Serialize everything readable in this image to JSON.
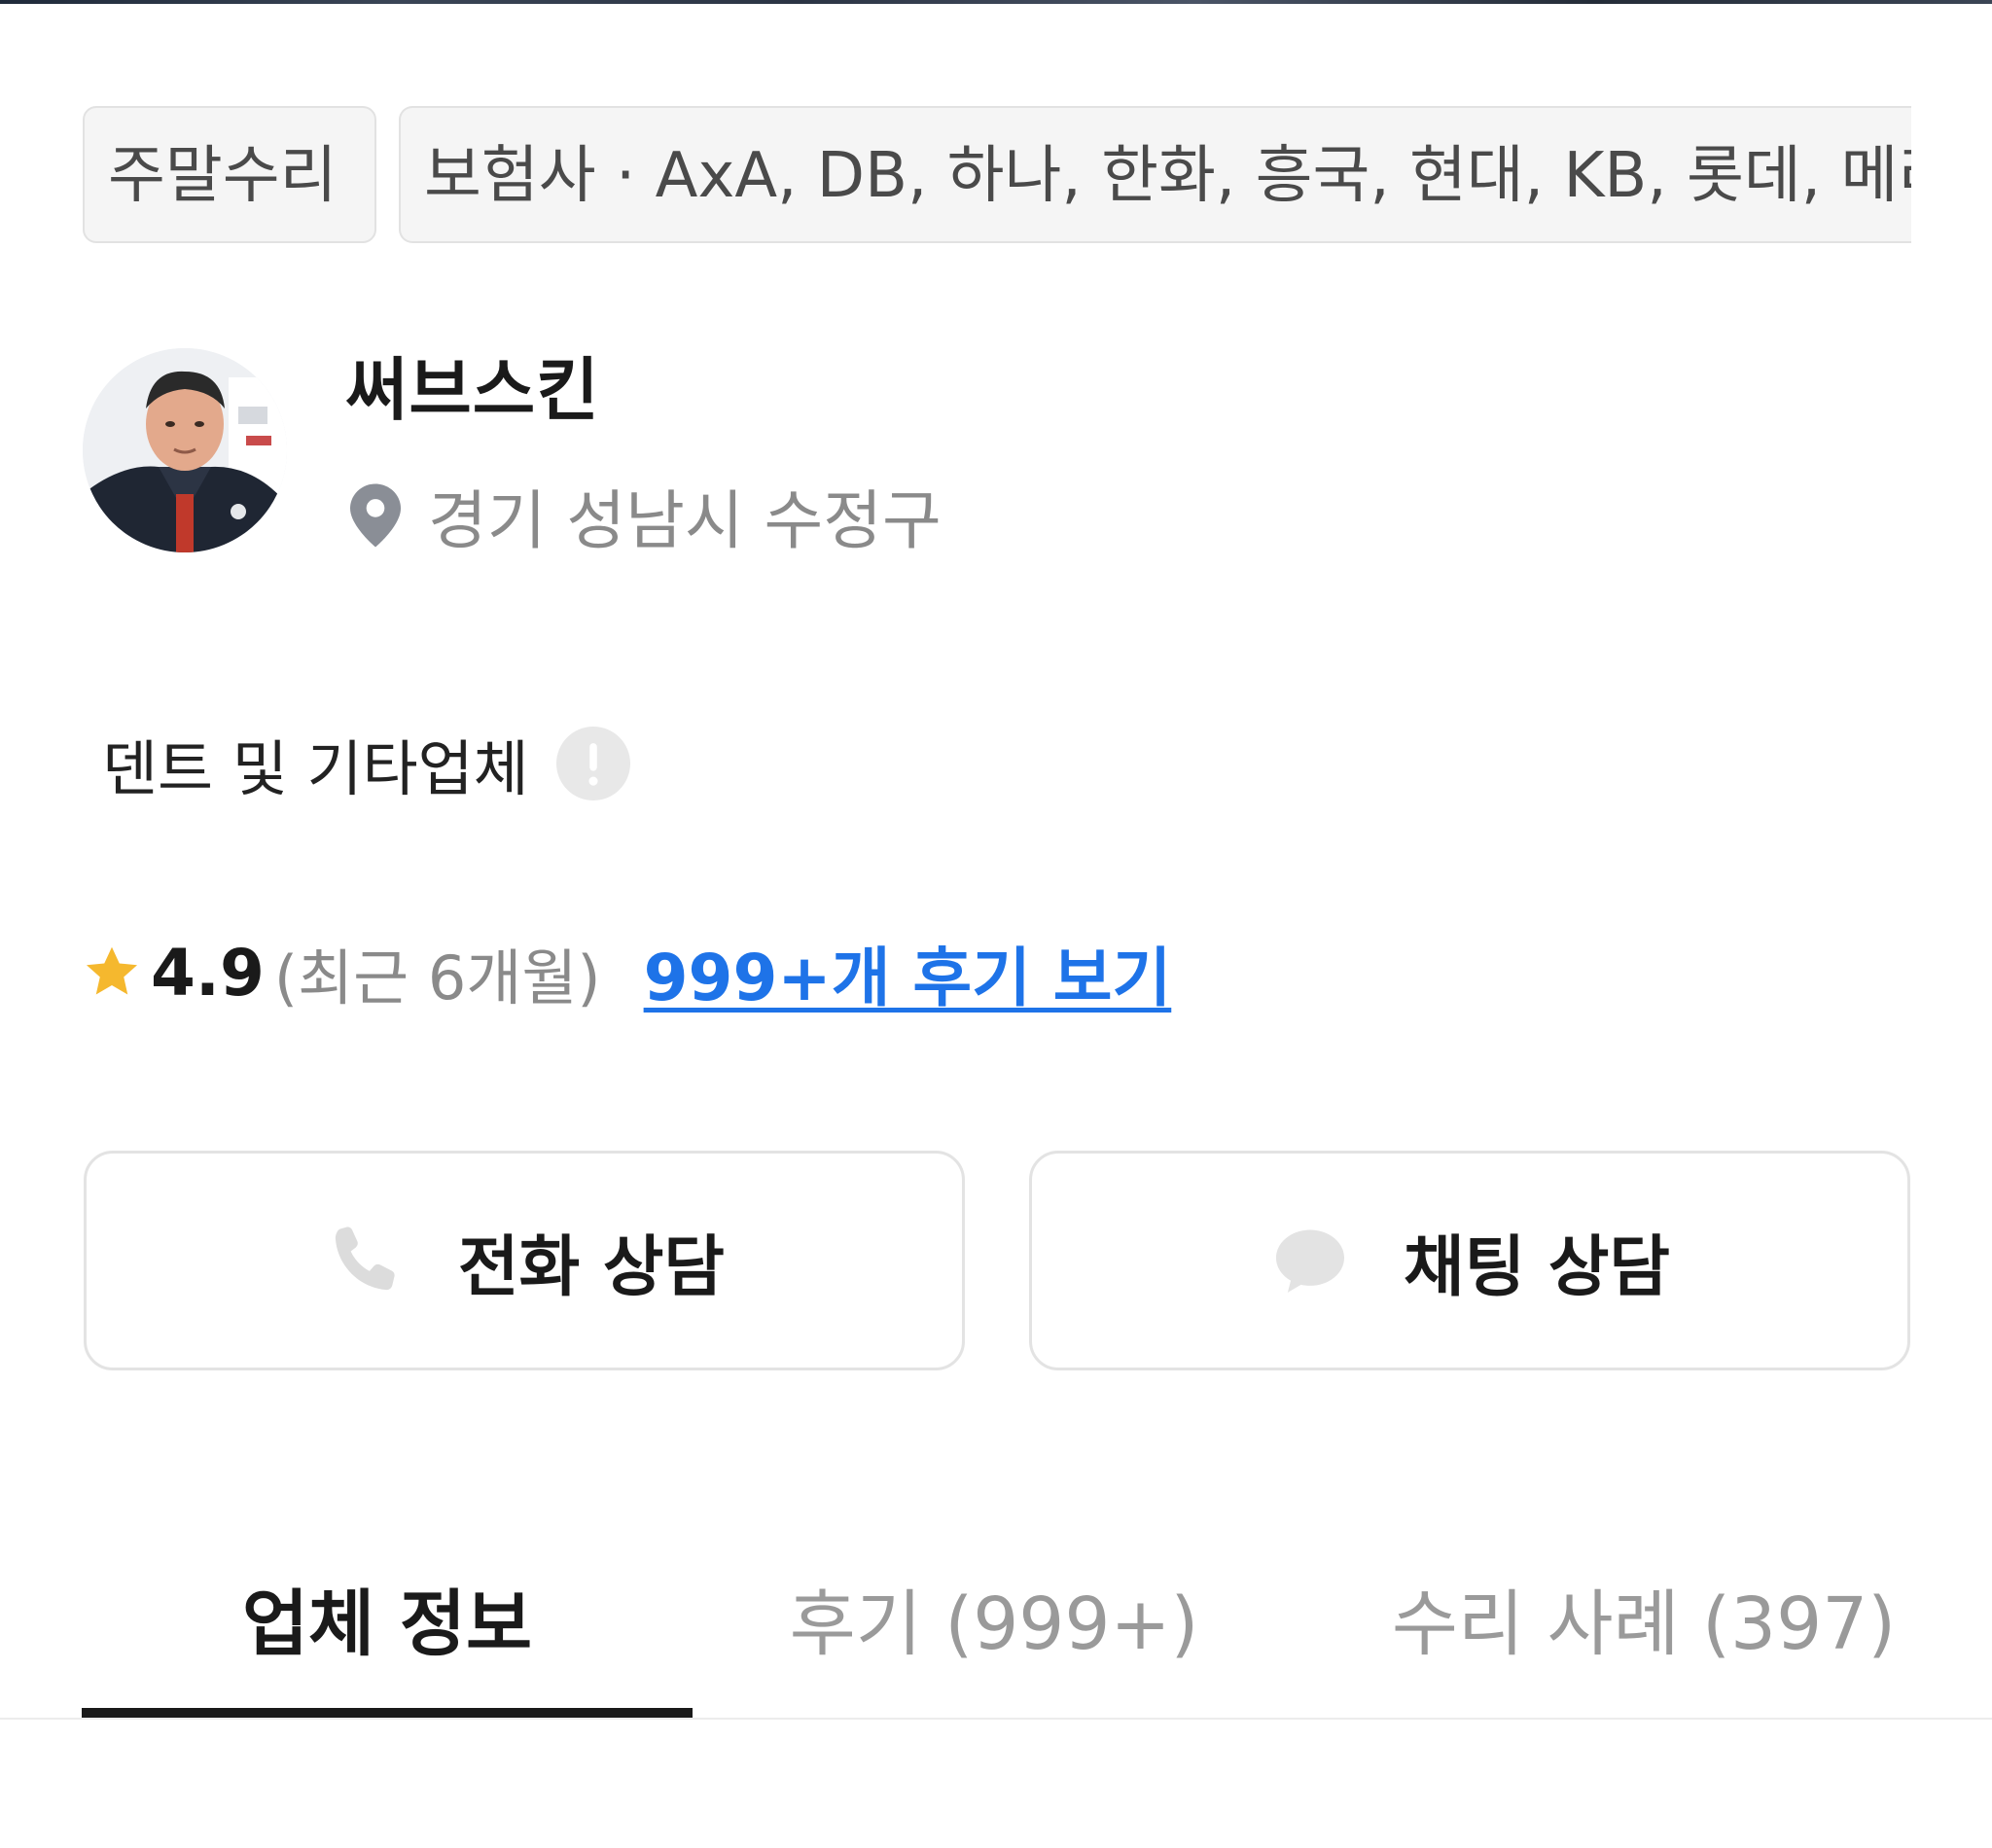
{
  "tags": {
    "weekend_repair": "주말수리",
    "insurance": "보험사 · AxA, DB, 하나, 한화, 흥국, 현대, KB, 롯데, 메리츠, 삼성"
  },
  "shop": {
    "name": "써브스킨",
    "location": "경기 성남시 수정구",
    "category": "덴트 및 기타업체"
  },
  "rating": {
    "value": "4.9",
    "period": "(최근 6개월)",
    "review_link": "999+개 후기 보기"
  },
  "buttons": {
    "call": "전화 상담",
    "chat": "채팅 상담"
  },
  "tabs": [
    {
      "label": "업체 정보",
      "active": true
    },
    {
      "label": "후기 (999+)",
      "active": false
    },
    {
      "label": "수리 사례 (397)",
      "active": false
    }
  ],
  "colors": {
    "accent_link": "#1e73e8",
    "star": "#f5b82e",
    "muted_text": "#8a8a8a",
    "chip_bg": "#f5f5f5"
  },
  "icons": {
    "location": "map-pin-icon",
    "info": "exclamation-circle-icon",
    "star": "star-icon",
    "call": "phone-icon",
    "chat": "chat-bubble-icon"
  }
}
